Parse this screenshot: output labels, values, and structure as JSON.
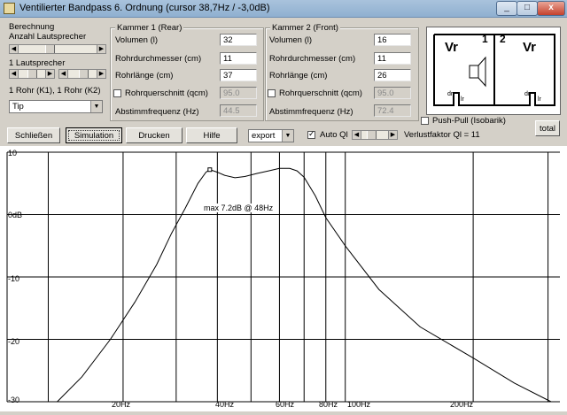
{
  "window": {
    "title": "Ventilierter Bandpass 6. Ordnung (cursor 38,7Hz / -3,0dB)",
    "buttons": [
      "_",
      "□",
      "x"
    ]
  },
  "left_group": {
    "title": "Berechnung",
    "anzahl_label": "Anzahl Lautsprecher",
    "laut_label": "1 Lautsprecher",
    "rohr_label": "1 Rohr (K1), 1 Rohr (K2)",
    "combo_value": "Tip"
  },
  "kammer1": {
    "title": "Kammer 1 (Rear)",
    "volumen_label": "Volumen (l)",
    "volumen": "32",
    "durchmesser_label": "Rohrdurchmesser (cm)",
    "durchmesser": "11",
    "laenge_label": "Rohrlänge (cm)",
    "laenge": "37",
    "querschnitt_label": "Rohrquerschnitt (qcm)",
    "querschnitt": "95.0",
    "abstimm_label": "Abstimmfrequenz (Hz)",
    "abstimm": "44.5"
  },
  "kammer2": {
    "title": "Kammer 2 (Front)",
    "volumen_label": "Volumen (l)",
    "volumen": "16",
    "durchmesser_label": "Rohrdurchmesser (cm)",
    "durchmesser": "11",
    "laenge_label": "Rohrlänge (cm)",
    "laenge": "26",
    "querschnitt_label": "Rohrquerschnitt (qcm)",
    "querschnitt": "95.0",
    "abstimm_label": "Abstimmfrequenz (Hz)",
    "abstimm": "72.4"
  },
  "diagram": {
    "label1": "1",
    "label2": "2",
    "vr_left": "Vr",
    "vr_right": "Vr",
    "dr": "dr",
    "lr": "lr"
  },
  "pushpull_label": "Push-Pull (Isobarik)",
  "toolbar": {
    "schliessen": "Schließen",
    "simulation": "Simulation",
    "drucken": "Drucken",
    "hilfe": "Hilfe",
    "export": "export",
    "autoql": "Auto Ql",
    "verlust": "Verlustfaktor Ql = 11",
    "total": "total"
  },
  "chart_data": {
    "type": "line",
    "x_scale": "log",
    "xlim": [
      16,
      320
    ],
    "ylim": [
      -30,
      10
    ],
    "y_ticks": [
      "10",
      "0dB",
      "-10",
      "-20",
      "-30"
    ],
    "x_ticks": [
      {
        "value": 20,
        "label": "20Hz"
      },
      {
        "value": 40,
        "label": "40Hz"
      },
      {
        "value": 60,
        "label": "60Hz"
      },
      {
        "value": 80,
        "label": "80Hz"
      },
      {
        "value": 100,
        "label": "100Hz"
      },
      {
        "value": 200,
        "label": "200Hz"
      }
    ],
    "x_grid": [
      20,
      30,
      40,
      50,
      60,
      70,
      80,
      90,
      100,
      200,
      300
    ],
    "y_grid": [
      10,
      0,
      -10,
      -20,
      -30
    ],
    "annotation": "max 7.2dB @ 48Hz",
    "peak": {
      "x": 48,
      "y": 7.2
    },
    "series": [
      {
        "x": [
          21,
          24,
          28,
          32,
          36,
          39,
          42,
          45,
          47,
          48,
          50,
          52,
          55,
          58,
          62,
          66,
          70,
          74,
          77,
          80,
          85,
          90,
          100,
          120,
          150,
          200,
          250,
          305
        ],
        "y": [
          -30,
          -26,
          -20,
          -14,
          -8,
          -3,
          1,
          5,
          6.8,
          7.2,
          6.8,
          6.3,
          5.9,
          6.1,
          6.6,
          7.0,
          7.4,
          7.4,
          7.0,
          6.0,
          3.0,
          -0.5,
          -5,
          -12,
          -18,
          -23,
          -27,
          -30
        ]
      }
    ],
    "colors": {
      "grid": "#000000",
      "curve": "#000000"
    }
  }
}
